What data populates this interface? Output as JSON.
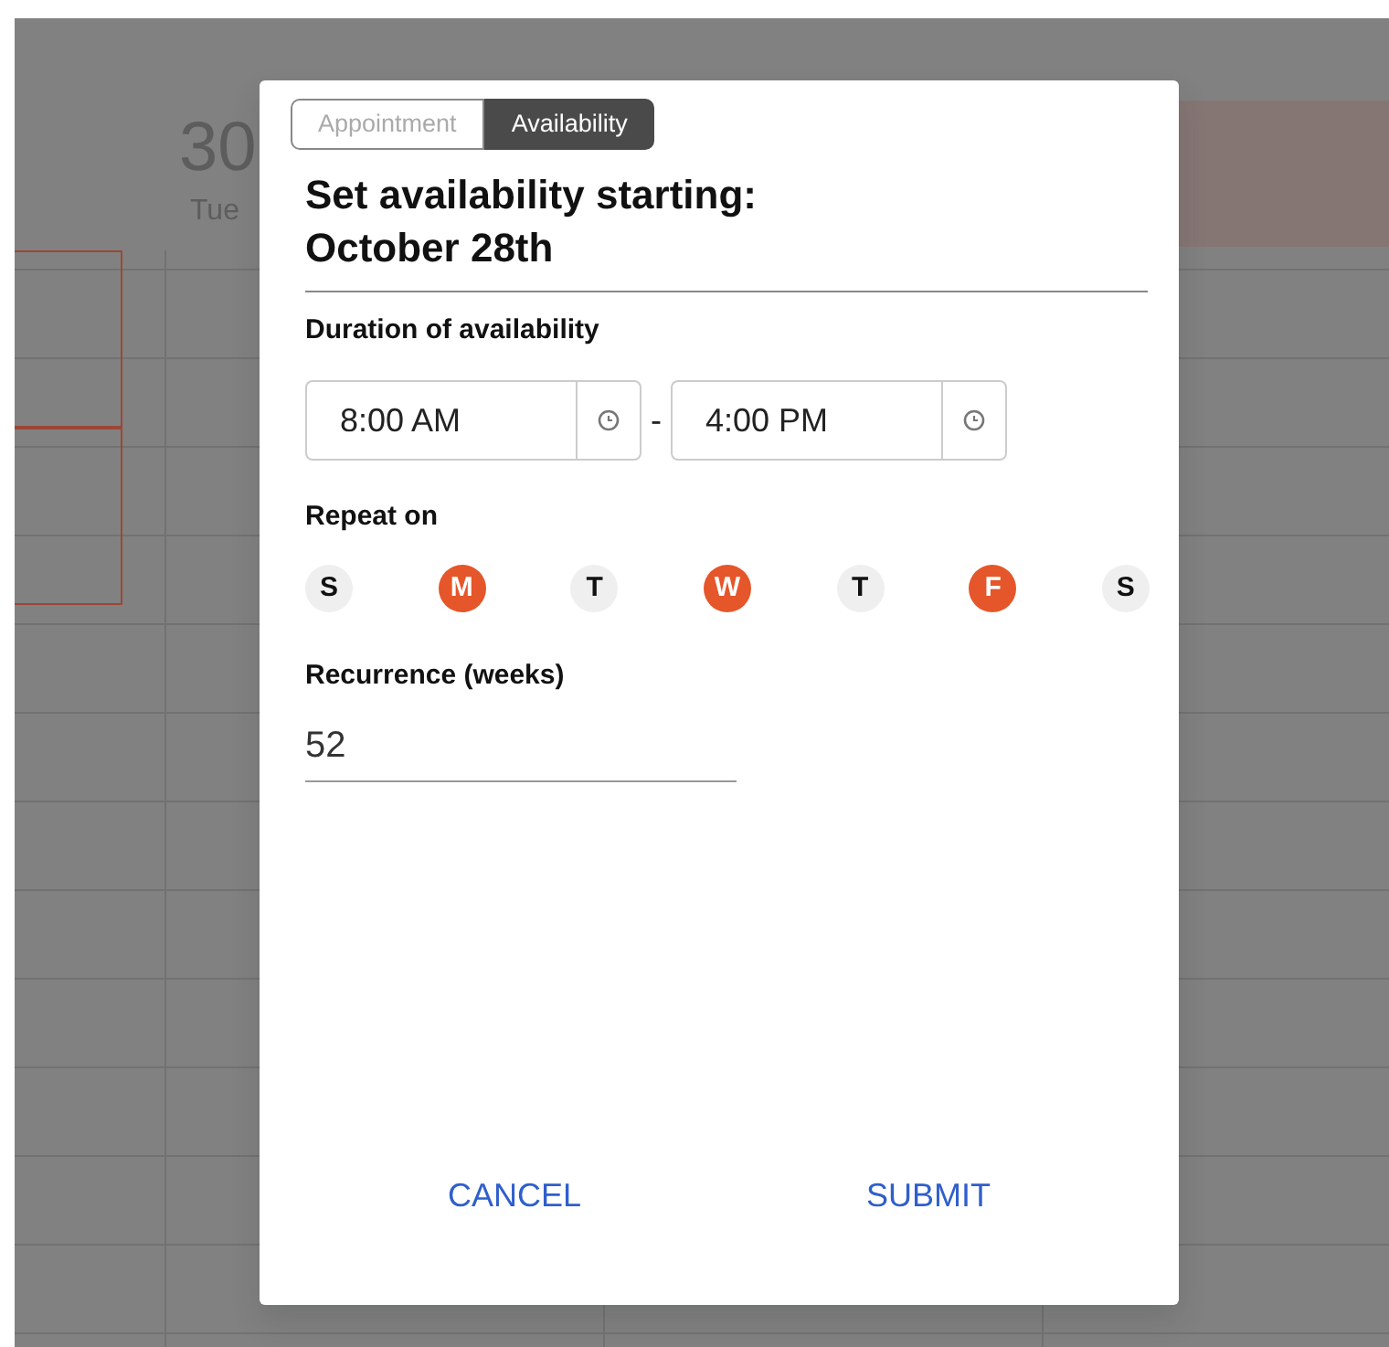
{
  "calendar": {
    "day_number": "30",
    "day_name": "Tue"
  },
  "dialog": {
    "tabs": [
      {
        "label": "Appointment",
        "selected": false
      },
      {
        "label": "Availability",
        "selected": true
      }
    ],
    "title": "Set availability starting: October 28th",
    "duration_label": "Duration of availability",
    "start_time": "8:00 AM",
    "separator": "-",
    "end_time": "4:00 PM",
    "repeat_label": "Repeat on",
    "days": [
      {
        "label": "S",
        "selected": false
      },
      {
        "label": "M",
        "selected": true
      },
      {
        "label": "T",
        "selected": false
      },
      {
        "label": "W",
        "selected": true
      },
      {
        "label": "T",
        "selected": false
      },
      {
        "label": "F",
        "selected": true
      },
      {
        "label": "S",
        "selected": false
      }
    ],
    "recurrence_label": "Recurrence (weeks)",
    "recurrence_value": "52",
    "buttons": [
      "CANCEL",
      "SUBMIT"
    ]
  }
}
